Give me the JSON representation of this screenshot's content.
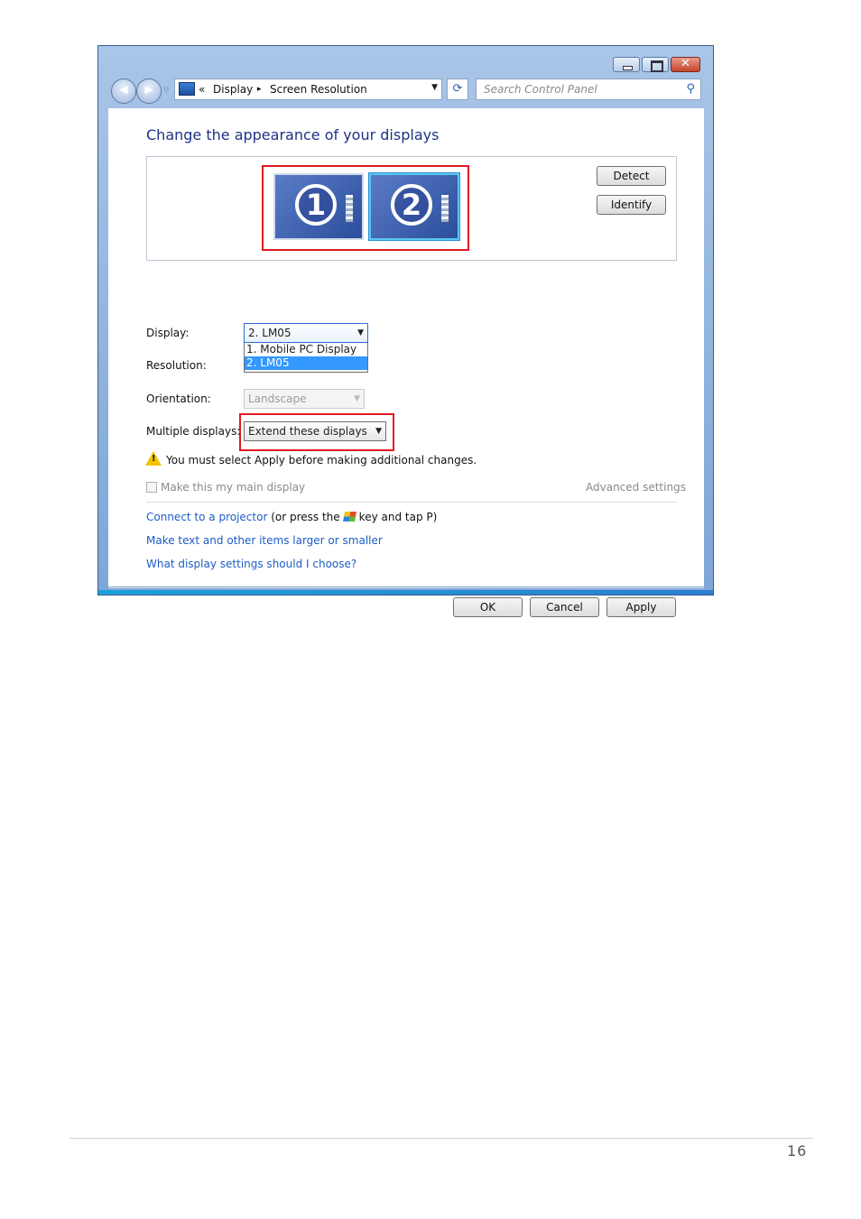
{
  "breadcrumb": {
    "prefix": "«",
    "items": [
      "Display",
      "Screen Resolution"
    ],
    "separator": "▸"
  },
  "search": {
    "placeholder": "Search Control Panel"
  },
  "caption": {
    "close": "✕"
  },
  "nav": {
    "back": "◀",
    "forward": "▶",
    "recent": "▽"
  },
  "heading": "Change the appearance of your displays",
  "monitors": [
    {
      "number": "1"
    },
    {
      "number": "2"
    }
  ],
  "buttons": {
    "detect": "Detect",
    "identify": "Identify",
    "ok": "OK",
    "cancel": "Cancel",
    "apply": "Apply"
  },
  "form": {
    "display_label": "Display:",
    "display_value": "2. LM05",
    "display_options": [
      "1. Mobile PC Display",
      "2. LM05"
    ],
    "resolution_label": "Resolution:",
    "orientation_label": "Orientation:",
    "orientation_value": "Landscape",
    "multiple_label": "Multiple displays:",
    "multiple_value": "Extend these displays"
  },
  "warning": "You must select Apply before making additional changes.",
  "main_display_label": "Make this my main display",
  "advanced": "Advanced settings",
  "links": {
    "projector": "Connect to a projector",
    "projector_suffix_a": "(or press the",
    "projector_suffix_b": "key and tap P)",
    "text_size": "Make text and other items larger or smaller",
    "help": "What display settings should I choose?"
  },
  "page_number": "16",
  "colors": {
    "highlight_border": "#e01a22",
    "link": "#1e5cc8",
    "heading": "#1e3287",
    "selection": "#3399ff"
  }
}
